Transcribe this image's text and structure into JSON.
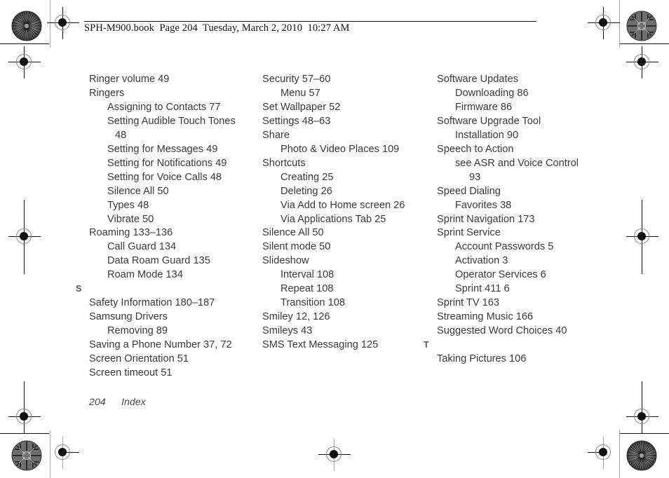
{
  "header": {
    "text": "SPH-M900.book  Page 204  Tuesday, March 2, 2010  10:27 AM"
  },
  "footer": {
    "page_number": "204",
    "section_name": "Index"
  },
  "columns": [
    {
      "id": "column-1",
      "entries": [
        {
          "level": 1,
          "text": "Ringer volume 49"
        },
        {
          "level": 1,
          "text": "Ringers"
        },
        {
          "level": 2,
          "text": "Assigning to Contacts 77"
        },
        {
          "level": 2,
          "text": "Setting Audible Touch Tones"
        },
        {
          "level": "cont1",
          "text": "48"
        },
        {
          "level": 2,
          "text": "Setting for Messages 49"
        },
        {
          "level": 2,
          "text": "Setting for Notifications 49"
        },
        {
          "level": 2,
          "text": "Setting for Voice Calls 48"
        },
        {
          "level": 2,
          "text": "Silence All 50"
        },
        {
          "level": 2,
          "text": "Types 48"
        },
        {
          "level": 2,
          "text": "Vibrate 50"
        },
        {
          "level": 1,
          "text": "Roaming 133–136"
        },
        {
          "level": 2,
          "text": "Call Guard 134"
        },
        {
          "level": 2,
          "text": "Data Roam Guard 135"
        },
        {
          "level": 2,
          "text": "Roam Mode 134"
        },
        {
          "level": "letter",
          "text": "S"
        },
        {
          "level": 1,
          "text": "Safety Information 180–187"
        },
        {
          "level": 1,
          "text": "Samsung Drivers"
        },
        {
          "level": 2,
          "text": "Removing 89"
        },
        {
          "level": 1,
          "text": "Saving a Phone Number 37, 72"
        },
        {
          "level": 1,
          "text": "Screen Orientation 51"
        },
        {
          "level": 1,
          "text": "Screen timeout 51"
        }
      ]
    },
    {
      "id": "column-2",
      "entries": [
        {
          "level": 1,
          "text": "Security 57–60"
        },
        {
          "level": 2,
          "text": "Menu 57"
        },
        {
          "level": 1,
          "text": "Set Wallpaper 52"
        },
        {
          "level": 1,
          "text": "Settings 48–63"
        },
        {
          "level": 1,
          "text": "Share"
        },
        {
          "level": 2,
          "text": "Photo & Video Places 109"
        },
        {
          "level": 1,
          "text": "Shortcuts"
        },
        {
          "level": 2,
          "text": "Creating 25"
        },
        {
          "level": 2,
          "text": "Deleting 26"
        },
        {
          "level": 2,
          "text": "Via Add to Home screen 26"
        },
        {
          "level": 2,
          "text": "Via Applications Tab 25"
        },
        {
          "level": 1,
          "text": "Silence All 50"
        },
        {
          "level": 1,
          "text": "Silent mode 50"
        },
        {
          "level": 1,
          "text": "Slideshow"
        },
        {
          "level": 2,
          "text": "Interval 108"
        },
        {
          "level": 2,
          "text": "Repeat 108"
        },
        {
          "level": 2,
          "text": "Transition 108"
        },
        {
          "level": 1,
          "text": "Smiley 12, 126"
        },
        {
          "level": 1,
          "text": "Smileys 43"
        },
        {
          "level": 1,
          "text": "SMS Text Messaging 125"
        }
      ]
    },
    {
      "id": "column-3",
      "entries": [
        {
          "level": 1,
          "text": "Software Updates"
        },
        {
          "level": 2,
          "text": "Downloading 86"
        },
        {
          "level": 2,
          "text": "Firmware 86"
        },
        {
          "level": 1,
          "text": "Software Upgrade Tool"
        },
        {
          "level": 2,
          "text": "Installation 90"
        },
        {
          "level": 1,
          "text": "Speech to Action"
        },
        {
          "level": 2,
          "text": "see ASR and Voice Control"
        },
        {
          "level": "cont2",
          "text": "93"
        },
        {
          "level": 1,
          "text": "Speed Dialing"
        },
        {
          "level": 2,
          "text": "Favorites 38"
        },
        {
          "level": 1,
          "text": "Sprint Navigation 173"
        },
        {
          "level": 1,
          "text": "Sprint Service"
        },
        {
          "level": 2,
          "text": "Account Passwords 5"
        },
        {
          "level": 2,
          "text": "Activation 3"
        },
        {
          "level": 2,
          "text": "Operator Services 6"
        },
        {
          "level": 2,
          "text": "Sprint 411 6"
        },
        {
          "level": 1,
          "text": "Sprint TV 163"
        },
        {
          "level": 1,
          "text": "Streaming Music 166"
        },
        {
          "level": 1,
          "text": "Suggested Word Choices 40"
        },
        {
          "level": "letter",
          "text": "T"
        },
        {
          "level": 1,
          "text": "Taking Pictures 106"
        }
      ]
    }
  ],
  "print_marks": {
    "registration_mark_label": "registration-target",
    "star_target_label": "radial-burst-target",
    "maze_target_label": "maze-rosette-target"
  },
  "colors": {
    "text": "#3a3a3a",
    "header_text": "#111111",
    "section_letter": "#58585a",
    "rule": "#111111",
    "guide_gray": "#a8a8a8"
  }
}
